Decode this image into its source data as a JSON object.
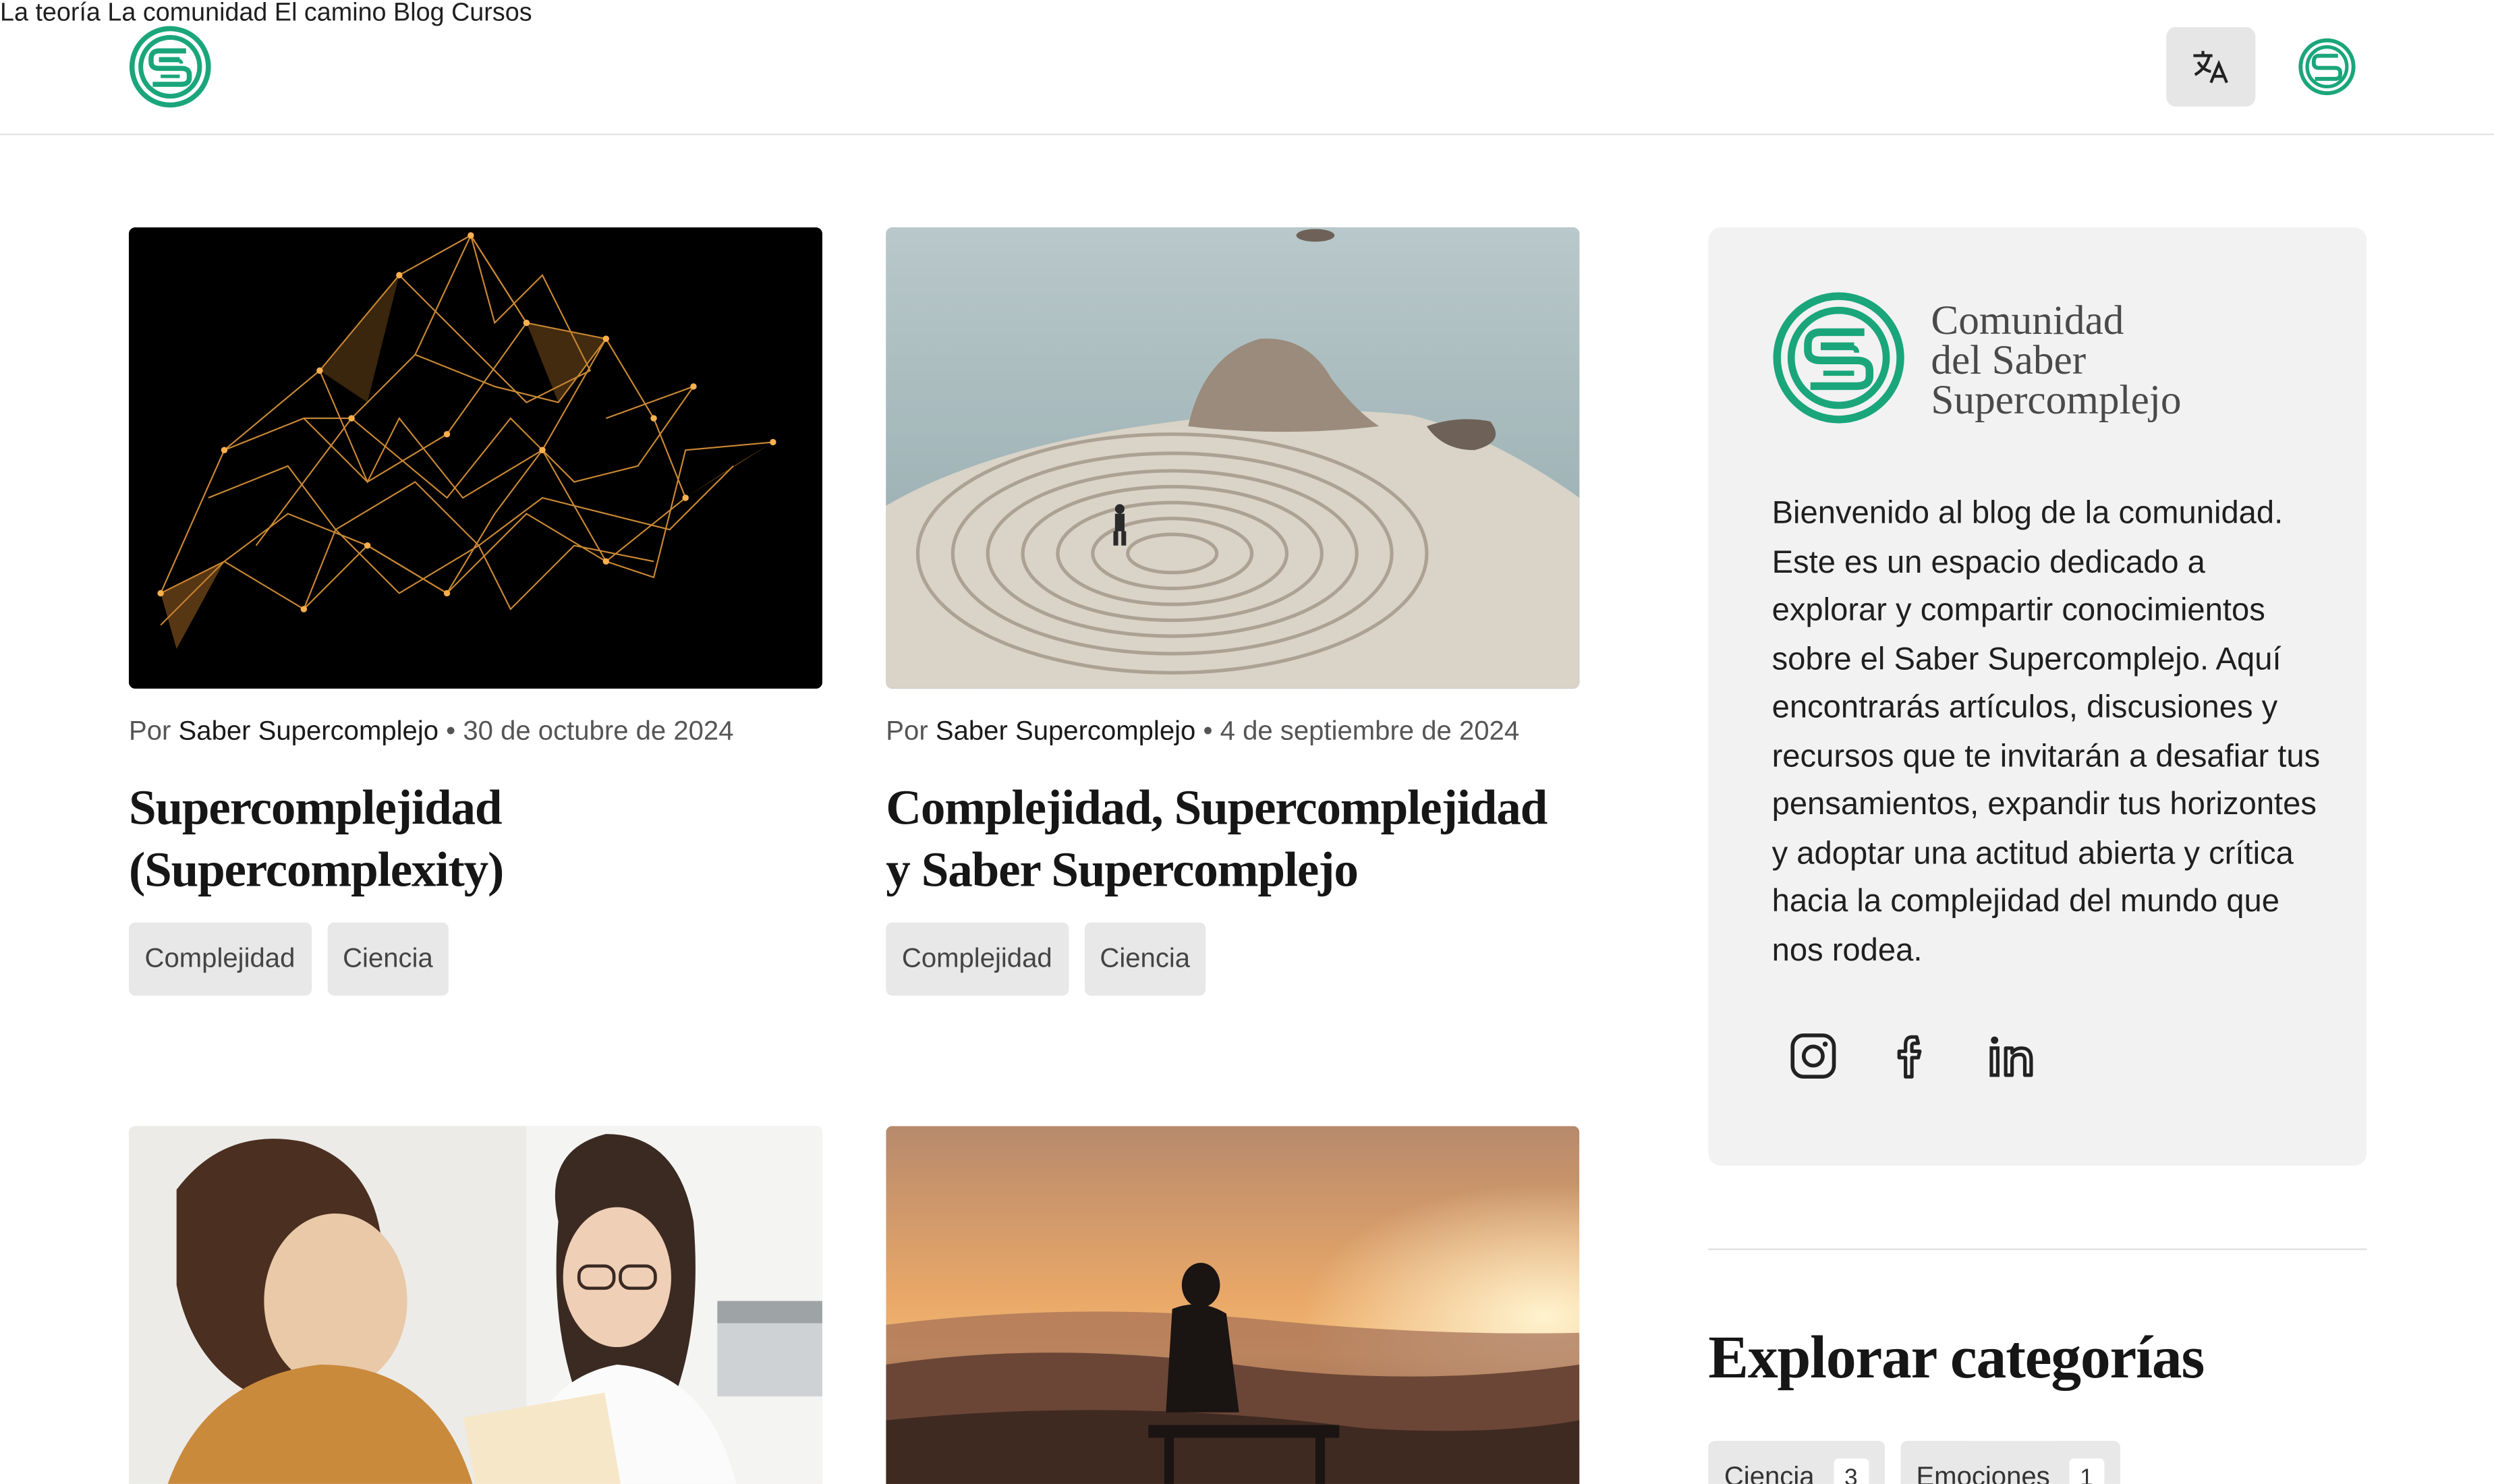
{
  "nav": {
    "items": [
      "La teoría",
      "La comunidad",
      "El camino",
      "Blog",
      "Cursos"
    ]
  },
  "colors": {
    "brand": "#1aa67a",
    "accent_dark": "#161616",
    "chip_bg": "#e8e8e8",
    "sidebar_bg": "#f2f2f2"
  },
  "posts": [
    {
      "by": "Por",
      "author": "Saber Supercomplejo",
      "date": "• 30 de octubre de 2024",
      "title_line1": "Supercomplejidad",
      "title_line2": "(Supercomplexity)",
      "tags": [
        "Complejidad",
        "Ciencia"
      ]
    },
    {
      "by": "Por",
      "author": "Saber Supercomplejo",
      "date": "• 4 de septiembre de 2024",
      "title_line1": "Complejidad, Supercomplejidad",
      "title_line2": "y Saber Supercomplejo",
      "tags": [
        "Complejidad",
        "Ciencia"
      ]
    }
  ],
  "sidebar": {
    "brand_lines": [
      "Comunidad",
      "del Saber",
      "Supercomplejo"
    ],
    "intro": "Bienvenido al blog de la comunidad. Este es un espacio dedicado a explorar y compartir conocimientos sobre el Saber Supercomplejo. Aquí encontrarás artículos, discusiones y recursos que te invitarán a desafiar tus pensamientos, expandir tus horizontes y adoptar una actitud abierta y crítica hacia la complejidad del mundo que nos rodea.",
    "socials": [
      "instagram-icon",
      "facebook-icon",
      "linkedin-icon"
    ],
    "categories_heading": "Explorar categorías",
    "categories": [
      {
        "name": "Ciencia",
        "count": "3"
      },
      {
        "name": "Emociones",
        "count": "1"
      }
    ]
  }
}
